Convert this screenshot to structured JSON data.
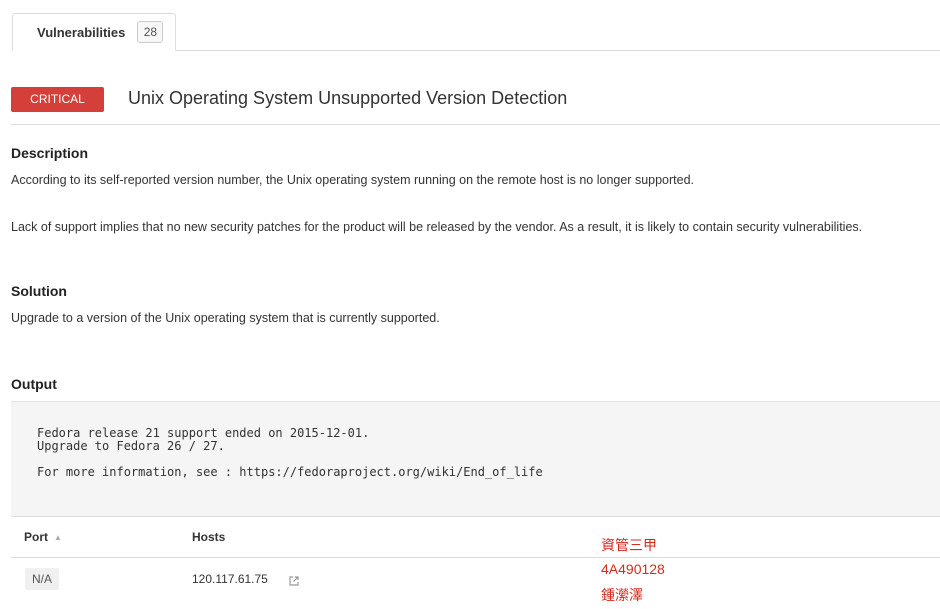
{
  "tabs": [
    {
      "label": "Vulnerabilities",
      "count": "28"
    }
  ],
  "vulnerability": {
    "severity": "CRITICAL",
    "title": "Unix Operating System Unsupported Version Detection"
  },
  "description": {
    "heading": "Description",
    "paragraphs": [
      "According to its self-reported version number, the Unix operating system running on the remote host is no longer supported.",
      "Lack of support implies that no new security patches for the product will be released by the vendor. As a result, it is likely to contain security vulnerabilities."
    ]
  },
  "solution": {
    "heading": "Solution",
    "text": "Upgrade to a version of the Unix operating system that is currently supported."
  },
  "output": {
    "heading": "Output",
    "text": "Fedora release 21 support ended on 2015-12-01.\nUpgrade to Fedora 26 / 27.\n\nFor more information, see : https://fedoraproject.org/wiki/End_of_life"
  },
  "table": {
    "columns": [
      "Port",
      "Hosts"
    ],
    "rows": [
      {
        "port": "N/A",
        "host": "120.117.61.75"
      }
    ]
  },
  "annotation": {
    "lines": [
      "資管三甲",
      "4A490128",
      "鍾瀠澤"
    ],
    "color": "#d52b1e"
  },
  "colors": {
    "severity_critical": "#d43f3a"
  },
  "icons": {
    "sort": "sort-up-icon",
    "external_link": "external-link-icon"
  }
}
